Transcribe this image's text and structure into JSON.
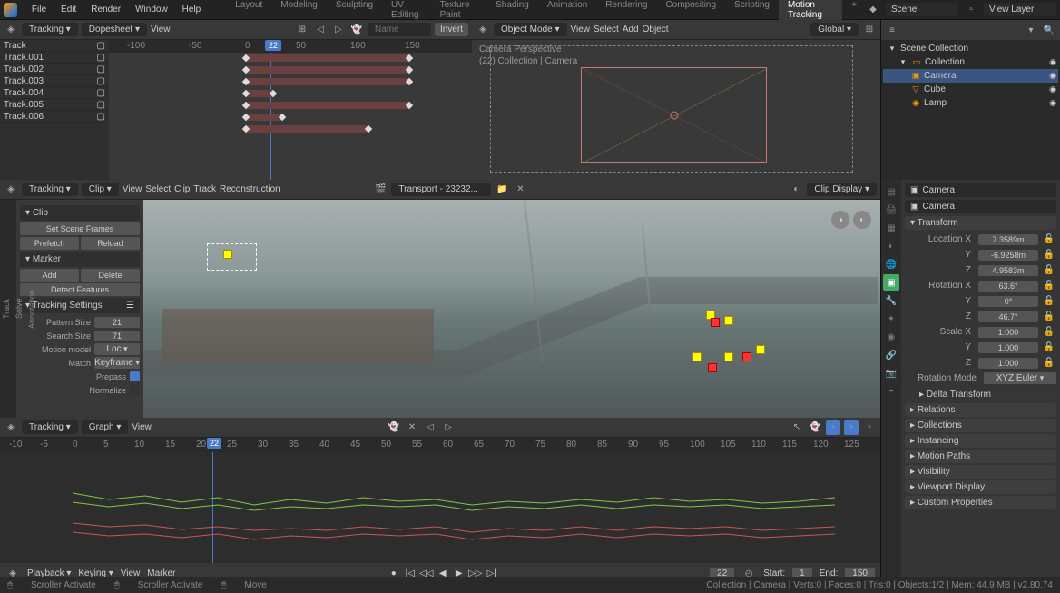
{
  "menubar": {
    "items": [
      "File",
      "Edit",
      "Render",
      "Window",
      "Help"
    ]
  },
  "workspaces": {
    "tabs": [
      "Layout",
      "Modeling",
      "Sculpting",
      "UV Editing",
      "Texture Paint",
      "Shading",
      "Animation",
      "Rendering",
      "Compositing",
      "Scripting",
      "Motion Tracking"
    ],
    "active": "Motion Tracking"
  },
  "scene": {
    "label": "Scene",
    "viewlayer": "View Layer"
  },
  "dopesheet": {
    "header": {
      "mode": "Tracking",
      "type": "Dopesheet",
      "view": "View",
      "search_placeholder": "Name",
      "invert": "Invert"
    },
    "ruler": [
      "-100",
      "-50",
      "0",
      "50",
      "100",
      "150"
    ],
    "current_frame": "22",
    "tracks": [
      "Track",
      "Track.001",
      "Track.002",
      "Track.003",
      "Track.004",
      "Track.005",
      "Track.006"
    ]
  },
  "viewport3d": {
    "header": {
      "mode": "Object Mode",
      "menus": [
        "View",
        "Select",
        "Add",
        "Object"
      ],
      "orientation": "Global"
    },
    "overlay": {
      "line1": "Camera Perspective",
      "line2": "(22) Collection | Camera"
    }
  },
  "outliner": {
    "root": "Scene Collection",
    "items": [
      {
        "name": "Collection",
        "indent": 1
      },
      {
        "name": "Camera",
        "indent": 2,
        "selected": true
      },
      {
        "name": "Cube",
        "indent": 2
      },
      {
        "name": "Lamp",
        "indent": 2
      }
    ]
  },
  "clip_editor": {
    "header": {
      "mode": "Tracking",
      "type": "Clip",
      "menus": [
        "View",
        "Select",
        "Clip",
        "Track",
        "Reconstruction"
      ],
      "clip_name": "Transport - 23232...",
      "display": "Clip Display"
    },
    "side_tabs": [
      "Track",
      "Solve",
      "Annotation"
    ],
    "panels": {
      "clip": {
        "title": "Clip",
        "set_scene": "Set Scene Frames",
        "prefetch": "Prefetch",
        "reload": "Reload"
      },
      "marker": {
        "title": "Marker",
        "add": "Add",
        "delete": "Delete",
        "detect": "Detect Features"
      },
      "tracking": {
        "title": "Tracking Settings",
        "pattern_label": "Pattern Size",
        "pattern_val": "21",
        "search_label": "Search Size",
        "search_val": "71",
        "motion_label": "Motion model",
        "motion_val": "Loc",
        "match_label": "Match",
        "match_val": "Keyframe",
        "prepass": "Prepass",
        "normalize": "Normalize"
      }
    }
  },
  "graph": {
    "header": {
      "mode": "Tracking",
      "type": "Graph",
      "view": "View"
    },
    "ruler": [
      "-10",
      "-5",
      "0",
      "5",
      "10",
      "15",
      "20",
      "25",
      "30",
      "35",
      "40",
      "45",
      "50",
      "55",
      "60",
      "65",
      "70",
      "75",
      "80",
      "85",
      "90",
      "95",
      "100",
      "105",
      "110",
      "115",
      "120",
      "125"
    ],
    "current_frame": "22"
  },
  "timeline": {
    "menus": [
      "Playback",
      "Keying",
      "View",
      "Marker"
    ],
    "current": "22",
    "start_label": "Start:",
    "start": "1",
    "end_label": "End:",
    "end": "150"
  },
  "properties": {
    "breadcrumb": "Camera",
    "object_name": "Camera",
    "transform": {
      "title": "Transform",
      "loc": {
        "x_label": "Location X",
        "x": "7.3589m",
        "y": "-6.9258m",
        "z": "4.9583m"
      },
      "rot": {
        "x_label": "Rotation X",
        "x": "63.6°",
        "y": "0°",
        "z": "46.7°"
      },
      "scale": {
        "x_label": "Scale X",
        "x": "1.000",
        "y": "1.000",
        "z": "1.000"
      },
      "rotmode_label": "Rotation Mode",
      "rotmode": "XYZ Euler",
      "delta": "Delta Transform"
    },
    "sections": [
      "Relations",
      "Collections",
      "Instancing",
      "Motion Paths",
      "Visibility",
      "Viewport Display",
      "Custom Properties"
    ]
  },
  "statusbar": {
    "left1": "Scroller Activate",
    "left2": "Scroller Activate",
    "left3": "Move",
    "right": "Collection | Camera | Verts:0 | Faces:0 | Tris:0 | Objects:1/2 | Mem: 44.9 MB | v2.80.74"
  }
}
